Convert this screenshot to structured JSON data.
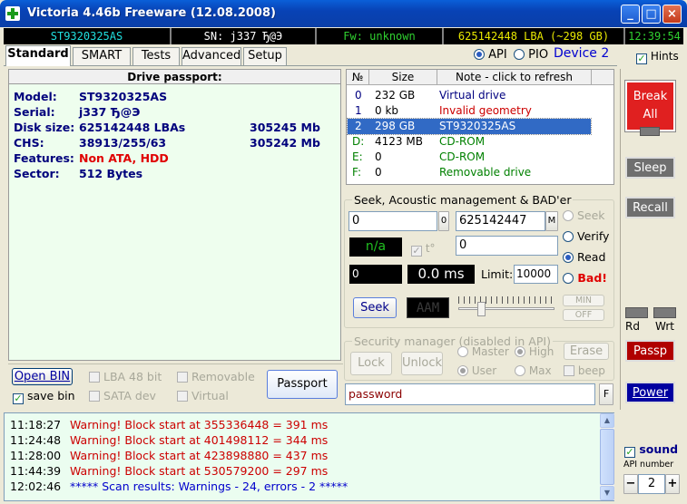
{
  "window": {
    "title": "Victoria 4.46b Freeware (12.08.2008)",
    "minimize": "_",
    "maximize": "□",
    "close": "×"
  },
  "status": {
    "model": "ST9320325AS",
    "serial": "SN: j337       Ђ@Э",
    "firmware": "Fw: unknown",
    "lba": "625142448 LBA (~298 GB)",
    "clock": "12:39:54"
  },
  "tabs": [
    "Standard",
    "SMART",
    "Tests",
    "Advanced",
    "Setup"
  ],
  "mode": {
    "api_label": "API",
    "pio_label": "PIO",
    "device": "Device 2",
    "hints_label": "Hints"
  },
  "passport": {
    "header": "Drive passport:",
    "rows": [
      {
        "label": "Model:",
        "value": "ST9320325AS",
        "extra": ""
      },
      {
        "label": "Serial:",
        "value": "j337       Ђ@Э",
        "extra": ""
      },
      {
        "label": "Disk size:",
        "value": "625142448 LBAs",
        "extra": "305245 Mb"
      },
      {
        "label": "CHS:",
        "value": "38913/255/63",
        "extra": "305242 Mb"
      },
      {
        "label": "Features:",
        "value": "Non ATA, HDD",
        "extra": ""
      },
      {
        "label": "Sector:",
        "value": "512 Bytes",
        "extra": ""
      }
    ]
  },
  "bottom_left": {
    "open_bin": "Open BIN",
    "save_bin": "save bin",
    "lba48": "LBA 48 bit",
    "sata": "SATA dev",
    "removable": "Removable",
    "virtual": "Virtual",
    "passport_btn": "Passport"
  },
  "drives": {
    "headers": [
      "№",
      "Size",
      "Note - click to refresh"
    ],
    "rows": [
      {
        "n": "0",
        "size": "232 GB",
        "note": "Virtual drive",
        "color": "#000080"
      },
      {
        "n": "1",
        "size": "0 kb",
        "note": "Invalid geometry",
        "color": "#cc0000"
      },
      {
        "n": "2",
        "size": "298 GB",
        "note": "ST9320325AS",
        "color": "#ffffff"
      },
      {
        "n": "D:",
        "size": "4123 MB",
        "note": "CD-ROM",
        "color": "#008000"
      },
      {
        "n": "E:",
        "size": "0",
        "note": "CD-ROM",
        "color": "#008000"
      },
      {
        "n": "F:",
        "size": "0",
        "note": "Removable drive",
        "color": "#008000"
      }
    ]
  },
  "seek": {
    "group": "Seek, Acoustic management & BAD'er",
    "start": "0",
    "start_btn": "0",
    "end": "625142447",
    "end_btn": "M",
    "na": "n/a",
    "temp": "t°",
    "field2": "0",
    "counter": "0",
    "time": "0.0 ms",
    "limit_label": "Limit:",
    "limit": "10000",
    "seek_btn": "Seek",
    "aam": "AAM",
    "min": "MIN",
    "off": "OFF",
    "radios": [
      "Seek",
      "Verify",
      "Read",
      "Bad!"
    ]
  },
  "security": {
    "group": "Security manager (disabled in API)",
    "lock": "Lock",
    "unlock": "Unlock",
    "master": "Master",
    "high": "High",
    "user": "User",
    "max": "Max",
    "erase": "Erase",
    "beep": "beep",
    "password": "password",
    "f": "F"
  },
  "right": {
    "break_all": "Break All",
    "sleep": "Sleep",
    "recall": "Recall",
    "rd": "Rd",
    "wrt": "Wrt",
    "passp": "Passp",
    "power": "Power",
    "sound": "sound",
    "api_number_label": "API number",
    "api_number": "2",
    "minus": "−",
    "plus": "+"
  },
  "log": [
    {
      "time": "11:18:27",
      "msg": "Warning! Block start at 355336448 = 391 ms",
      "color": "#cc0000"
    },
    {
      "time": "11:24:48",
      "msg": "Warning! Block start at 401498112 = 344 ms",
      "color": "#cc0000"
    },
    {
      "time": "11:28:00",
      "msg": "Warning! Block start at 423898880 = 437 ms",
      "color": "#cc0000"
    },
    {
      "time": "11:44:39",
      "msg": "Warning! Block start at 530579200 = 297 ms",
      "color": "#cc0000"
    },
    {
      "time": "12:02:46",
      "msg": "***** Scan results: Warnings - 24, errors - 2 *****",
      "color": "#0000cc"
    }
  ],
  "colors": {
    "titlebar": "#0842b5",
    "passport_bg": "#eefeee",
    "selected_row": "#316ac5",
    "break_all": "#e02020",
    "passp": "#b00000",
    "power": "#0000a0"
  }
}
